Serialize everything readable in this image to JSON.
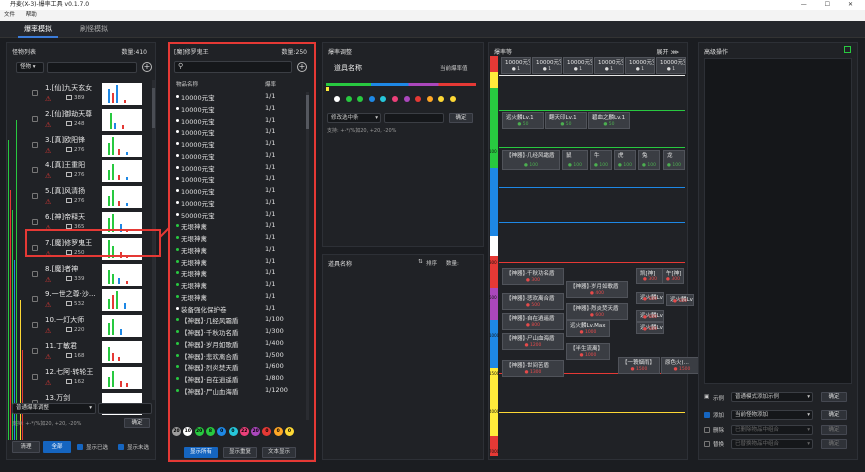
{
  "window": {
    "title": "丹麦(X-3)-爆率工具 v0.1.7.0",
    "controls": "— ☐ ✕"
  },
  "menu": [
    "文件",
    "帮助"
  ],
  "tabs": [
    "爆率模拟",
    "刷怪模拟"
  ],
  "monster_panel": {
    "title": "怪物列表",
    "count": "数量:410",
    "filter": "怪物",
    "items": [
      {
        "name": "1.[仙]九天玄女",
        "count": "389"
      },
      {
        "name": "2.[仙]御劫天尊",
        "count": "248"
      },
      {
        "name": "3.[真]欧阳锋",
        "count": "276"
      },
      {
        "name": "4.[真]王重阳",
        "count": "276"
      },
      {
        "name": "5.[真]风清扬",
        "count": "276"
      },
      {
        "name": "6.[神]帝释天",
        "count": "365"
      },
      {
        "name": "7.[魔]修罗鬼王",
        "count": "250"
      },
      {
        "name": "8.[魔]者神",
        "count": "339"
      },
      {
        "name": "9.一世之尊·沙...",
        "count": "532"
      },
      {
        "name": "10.一灯大师",
        "count": "220"
      },
      {
        "name": "11.丁敏君",
        "count": "168"
      },
      {
        "name": "12.七阿·转轮王",
        "count": "162"
      },
      {
        "name": "13.万剑",
        "count": ""
      }
    ],
    "mode_select": "普通爆率调整",
    "support_text": "支持: +-*/%如20, +20, -20%",
    "confirm": "确定",
    "btn_clear": "清理",
    "btn_all": "全部",
    "chk_selected": "显示已选",
    "chk_unselected": "显示未选"
  },
  "drops_panel": {
    "title": "[魔]修罗鬼王",
    "count": "数量:250",
    "col_name": "物品名称",
    "col_rate": "爆率",
    "rows": [
      {
        "name": "10000元宝",
        "rate": "1/1"
      },
      {
        "name": "10000元宝",
        "rate": "1/1"
      },
      {
        "name": "10000元宝",
        "rate": "1/1"
      },
      {
        "name": "10000元宝",
        "rate": "1/1"
      },
      {
        "name": "10000元宝",
        "rate": "1/1"
      },
      {
        "name": "10000元宝",
        "rate": "1/1"
      },
      {
        "name": "10000元宝",
        "rate": "1/1"
      },
      {
        "name": "10000元宝",
        "rate": "1/1"
      },
      {
        "name": "10000元宝",
        "rate": "1/1"
      },
      {
        "name": "10000元宝",
        "rate": "1/1"
      },
      {
        "name": "50000元宝",
        "rate": "1/1"
      },
      {
        "name": "无垠神禽",
        "rate": "1/1"
      },
      {
        "name": "无垠神禽",
        "rate": "1/1"
      },
      {
        "name": "无垠神禽",
        "rate": "1/1"
      },
      {
        "name": "无垠神禽",
        "rate": "1/1"
      },
      {
        "name": "无垠神禽",
        "rate": "1/1"
      },
      {
        "name": "无垠神禽",
        "rate": "1/1"
      },
      {
        "name": "无垠神禽",
        "rate": "1/1"
      },
      {
        "name": "装备强化保护卷",
        "rate": "1/1"
      },
      {
        "name": "【神器】·几经风霜盾",
        "rate": "1/100"
      },
      {
        "name": "【神器】·千秋功名盾",
        "rate": "1/300"
      },
      {
        "name": "【神器】·岁月如歌盾",
        "rate": "1/400"
      },
      {
        "name": "【神器】·悲欢离合盾",
        "rate": "1/500"
      },
      {
        "name": "【神器】·烈炎焚天盾",
        "rate": "1/600"
      },
      {
        "name": "【神器】·自在逍遥盾",
        "rate": "1/800"
      },
      {
        "name": "【神器】·尸山血海盾",
        "rate": "1/1200"
      }
    ],
    "color_counts": [
      "20",
      "10",
      "20",
      "8",
      "0",
      "0",
      "22",
      "20",
      "0",
      "0",
      "0"
    ],
    "btn_show_all": "显示所有",
    "btn_show_dup": "显示重复",
    "btn_show_text": "文本显示"
  },
  "adjust_panel": {
    "title": "爆率调整",
    "item_name_label": "道具名称",
    "current_rate_label": "当前爆率值",
    "select_placeholder": "修改选中条",
    "support_text": "支持: +-*/%如20, +20, -20%",
    "confirm": "确定",
    "list_item_label": "道具名称",
    "sort_label": "排序",
    "qty_label": "数量:"
  },
  "rate_panel": {
    "title": "爆率等",
    "expand": "展开 ⋙",
    "top_cards": [
      {
        "name": "10000元宝",
        "sub": "● 1"
      },
      {
        "name": "10000元宝",
        "sub": "● 1"
      },
      {
        "name": "10000元宝",
        "sub": "● 1"
      },
      {
        "name": "10000元宝",
        "sub": "● 1"
      },
      {
        "name": "10000元宝",
        "sub": "● 1"
      },
      {
        "name": "10000元宝",
        "sub": "● 1"
      }
    ],
    "mid_cards": [
      {
        "name": "远火麟Lv.1",
        "sub": "● 50"
      },
      {
        "name": "翻天印Lv.1",
        "sub": "● 50"
      },
      {
        "name": "碧血之麟Lv.1",
        "sub": "● 50"
      }
    ],
    "zodiac_cards": [
      {
        "name": "【神器】·几经风霜盾",
        "sub": "● 100"
      },
      {
        "name": "鼠",
        "sub": "● 100"
      },
      {
        "name": "牛",
        "sub": "● 100"
      },
      {
        "name": "虎",
        "sub": "● 100"
      },
      {
        "name": "兔",
        "sub": "● 100"
      },
      {
        "name": "龙",
        "sub": "● 100"
      }
    ],
    "red_cards": [
      {
        "name": "【神器】·千秋功名盾",
        "sub": "● 300"
      },
      {
        "name": "【神器】·岁月如歌盾",
        "sub": "● 400"
      },
      {
        "name": "【神器】·悲欢离合盾",
        "sub": "● 500"
      },
      {
        "name": "【神器】·烈炎焚天盾",
        "sub": "● 600"
      },
      {
        "name": "【神器】·自在逍遥盾",
        "sub": "● 800"
      },
      {
        "name": "【神器】·尸山血海盾",
        "sub": "● 1200"
      },
      {
        "name": "远火麟Lv.Max",
        "sub": "● 1000"
      },
      {
        "name": "【半生流离】",
        "sub": "● 1000"
      },
      {
        "name": "【神器】·世间苦盾",
        "sub": "● 1300"
      },
      {
        "name": "【一蓑烟雨】",
        "sub": "● 1500"
      },
      {
        "name": "原色火(...",
        "sub": "● 1500"
      }
    ],
    "side_cards": [
      {
        "name": "凯[神]",
        "sub": "● 300"
      },
      {
        "name": "午[神]",
        "sub": "● 300"
      },
      {
        "name": "远火麟Lv.8",
        "sub": "● 500"
      },
      {
        "name": "远火麟Lv.6",
        "sub": "● 500"
      },
      {
        "name": "远火麟Lv.4",
        "sub": "● 600"
      },
      {
        "name": "远火麟Lv.2",
        "sub": "● 500"
      }
    ],
    "axis_labels": [
      "100",
      "300",
      "500",
      "1000",
      "1500",
      "4000",
      "7000"
    ]
  },
  "advanced_panel": {
    "title": "高级操作",
    "row1_label": "示例",
    "row1_value": "普通模式添加示例",
    "row1_btn": "确定",
    "row2_label": "添加",
    "row2_value": "当前怪物添加",
    "row2_btn": "确定",
    "row3_label": "删除",
    "row3_value": "已删除物品中组合",
    "row3_btn": "确定",
    "row4_label": "替换",
    "row4_value": "已替换物品中组合",
    "row4_btn": "确定"
  },
  "colors": {
    "accent": "#1565c0",
    "highlight_red": "#e53935",
    "bg": "#1b1d21"
  }
}
